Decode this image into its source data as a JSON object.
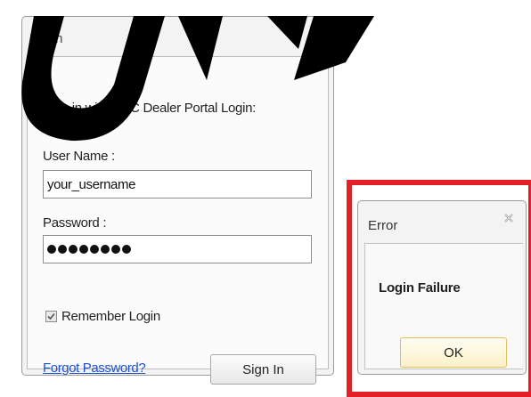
{
  "login": {
    "title": "Login",
    "instruction": "Sign in with URC Dealer Portal Login:",
    "username_label": "User Name :",
    "username_value": "your_username",
    "password_label": "Password :",
    "password_length": 8,
    "remember_label": "Remember Login",
    "remember_checked": true,
    "forgot_link": "Forgot Password?",
    "signin_label": "Sign In",
    "close_icon": "close-icon"
  },
  "error": {
    "title": "Error",
    "message": "Login Failure",
    "ok_label": "OK",
    "close_icon": "close-icon"
  },
  "colors": {
    "highlight_frame": "#e41f26",
    "link": "#1f4fd1",
    "ok_button_border": "#e6bd57"
  }
}
